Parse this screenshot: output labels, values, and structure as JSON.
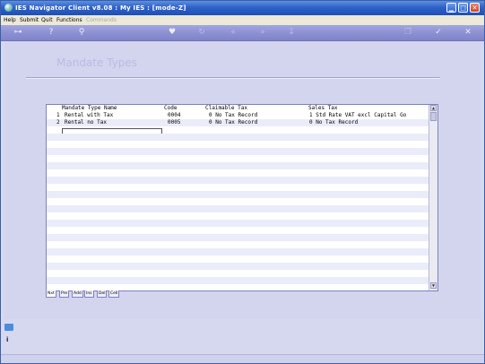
{
  "window": {
    "title": "IES Navigator Client v8.08 : My IES :      [mode-Z]"
  },
  "menu": {
    "items": [
      "Help",
      "Submit",
      "Quit",
      "Functions"
    ],
    "disabled_item": "Commands"
  },
  "toolbar": {
    "icons": [
      {
        "name": "key-icon",
        "glyph": "⊶"
      },
      {
        "name": "help-icon",
        "glyph": "?"
      },
      {
        "name": "search-icon",
        "glyph": "⚲"
      },
      {
        "name": "heart-icon",
        "glyph": "♥"
      },
      {
        "name": "refresh-icon",
        "glyph": "↻"
      },
      {
        "name": "rewind-icon",
        "glyph": "«"
      },
      {
        "name": "fast-forward-icon",
        "glyph": "»"
      },
      {
        "name": "download-icon",
        "glyph": "↧"
      },
      {
        "name": "copy-icon",
        "glyph": "❐"
      },
      {
        "name": "check-icon",
        "glyph": "✓"
      },
      {
        "name": "close-icon",
        "glyph": "✕"
      }
    ]
  },
  "page": {
    "title": "Mandate Types"
  },
  "grid": {
    "headers": [
      "Mandate Type Name",
      "Code",
      "Claimable Tax",
      "Sales Tax"
    ],
    "rows": [
      {
        "num": "1",
        "name": "Rental with Tax",
        "code": "0004",
        "claimable": "0 No Tax Record",
        "sales": "1 Std Rate VAT excl Capital Go"
      },
      {
        "num": "2",
        "name": "Rental no Tax",
        "code": "0005",
        "claimable": "0 No Tax Record",
        "sales": "0 No Tax Record"
      }
    ],
    "scroll_up": "▲",
    "scroll_down": "▼"
  },
  "tabs": [
    "Nxt",
    "Pre",
    "Add",
    "Ins",
    "Del",
    "Cell"
  ],
  "sidebar": {
    "info": "i"
  }
}
